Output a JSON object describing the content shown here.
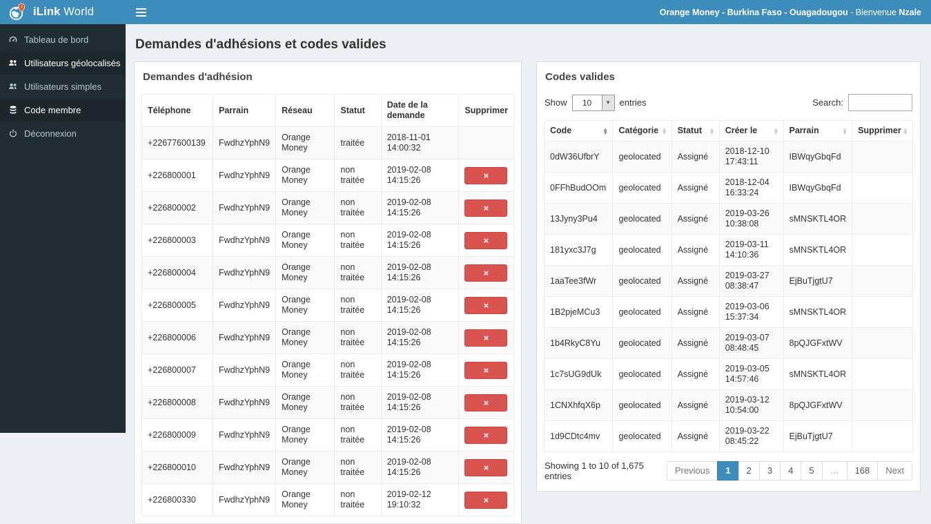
{
  "page_title": "Demandes d'adhésions et codes valides",
  "brand": {
    "bold": "iLink",
    "rest": " World"
  },
  "topbar": {
    "segments": [
      {
        "text": "Orange Money",
        "bold": true
      },
      {
        "text": " - ",
        "bold": true
      },
      {
        "text": "Burkina Faso",
        "bold": true
      },
      {
        "text": " - ",
        "bold": true
      },
      {
        "text": "Ouagadougou",
        "bold": true
      },
      {
        "text": " - ",
        "bold": false
      },
      {
        "text": "Bienvenue ",
        "bold": false
      },
      {
        "text": "Nzale",
        "bold": true
      }
    ]
  },
  "sidebar": {
    "items": [
      {
        "id": "tableau-de-bord",
        "label": "Tableau de bord",
        "icon": "dashboard-icon",
        "active": false
      },
      {
        "id": "utilisateurs-geolocalises",
        "label": "Utilisateurs géolocalisés",
        "icon": "users-icon",
        "active": true
      },
      {
        "id": "utilisateurs-simples",
        "label": "Utilisateurs simples",
        "icon": "users-icon",
        "active": false
      },
      {
        "id": "code-membre",
        "label": "Code membre",
        "icon": "database-icon",
        "active": true
      },
      {
        "id": "deconnexion",
        "label": "Déconnexion",
        "icon": "power-icon",
        "active": false
      }
    ]
  },
  "left_panel": {
    "title": "Demandes d'adhésion",
    "columns": [
      "Téléphone",
      "Parrain",
      "Réseau",
      "Statut",
      "Date de la demande",
      "Supprimer"
    ],
    "delete_icon": "×",
    "rows": [
      {
        "telephone": "+22677600139",
        "parrain": "FwdhzYphN9",
        "reseau": "Orange Money",
        "statut": "traitée",
        "date": "2018-11-01 14:00:32",
        "deletable": false
      },
      {
        "telephone": "+226800001",
        "parrain": "FwdhzYphN9",
        "reseau": "Orange Money",
        "statut": "non traitée",
        "date": "2019-02-08 14:15:26",
        "deletable": true
      },
      {
        "telephone": "+226800002",
        "parrain": "FwdhzYphN9",
        "reseau": "Orange Money",
        "statut": "non traitée",
        "date": "2019-02-08 14:15:26",
        "deletable": true
      },
      {
        "telephone": "+226800003",
        "parrain": "FwdhzYphN9",
        "reseau": "Orange Money",
        "statut": "non traitée",
        "date": "2019-02-08 14:15:26",
        "deletable": true
      },
      {
        "telephone": "+226800004",
        "parrain": "FwdhzYphN9",
        "reseau": "Orange Money",
        "statut": "non traitée",
        "date": "2019-02-08 14:15:26",
        "deletable": true
      },
      {
        "telephone": "+226800005",
        "parrain": "FwdhzYphN9",
        "reseau": "Orange Money",
        "statut": "non traitée",
        "date": "2019-02-08 14:15:26",
        "deletable": true
      },
      {
        "telephone": "+226800006",
        "parrain": "FwdhzYphN9",
        "reseau": "Orange Money",
        "statut": "non traitée",
        "date": "2019-02-08 14:15:26",
        "deletable": true
      },
      {
        "telephone": "+226800007",
        "parrain": "FwdhzYphN9",
        "reseau": "Orange Money",
        "statut": "non traitée",
        "date": "2019-02-08 14:15:26",
        "deletable": true
      },
      {
        "telephone": "+226800008",
        "parrain": "FwdhzYphN9",
        "reseau": "Orange Money",
        "statut": "non traitée",
        "date": "2019-02-08 14:15:26",
        "deletable": true
      },
      {
        "telephone": "+226800009",
        "parrain": "FwdhzYphN9",
        "reseau": "Orange Money",
        "statut": "non traitée",
        "date": "2019-02-08 14:15:26",
        "deletable": true
      },
      {
        "telephone": "+226800010",
        "parrain": "FwdhzYphN9",
        "reseau": "Orange Money",
        "statut": "non traitée",
        "date": "2019-02-08 14:15:26",
        "deletable": true
      },
      {
        "telephone": "+226800330",
        "parrain": "FwdhzYphN9",
        "reseau": "Orange Money",
        "statut": "non traitée",
        "date": "2019-02-12 19:10:32",
        "deletable": true
      }
    ]
  },
  "right_panel": {
    "title": "Codes valides",
    "show_label": "Show",
    "page_size": "10",
    "entries_label": "entries",
    "search_label": "Search:",
    "search_value": "",
    "columns": [
      {
        "label": "Code",
        "sorted": true
      },
      {
        "label": "Catégorie",
        "sorted": false
      },
      {
        "label": "Statut",
        "sorted": false
      },
      {
        "label": "Créer le",
        "sorted": false
      },
      {
        "label": "Parrain",
        "sorted": false
      },
      {
        "label": "Supprimer",
        "sorted": false
      }
    ],
    "rows": [
      {
        "code": "0dW36UfbrY",
        "categorie": "geolocated",
        "statut": "Assigné",
        "cree_le": "2018-12-10 17:43:11",
        "parrain": "IBWqyGbqFd"
      },
      {
        "code": "0FFhBudOOm",
        "categorie": "geolocated",
        "statut": "Assigné",
        "cree_le": "2018-12-04 16:33:24",
        "parrain": "IBWqyGbqFd"
      },
      {
        "code": "13Jyny3Pu4",
        "categorie": "geolocated",
        "statut": "Assigné",
        "cree_le": "2019-03-26 10:38:08",
        "parrain": "sMNSKTL4OR"
      },
      {
        "code": "181yxc3J7g",
        "categorie": "geolocated",
        "statut": "Assigné",
        "cree_le": "2019-03-11 14:10:36",
        "parrain": "sMNSKTL4OR"
      },
      {
        "code": "1aaTee3fWr",
        "categorie": "geolocated",
        "statut": "Assigné",
        "cree_le": "2019-03-27 08:38:47",
        "parrain": "EjBuTjgtU7"
      },
      {
        "code": "1B2pjeMCu3",
        "categorie": "geolocated",
        "statut": "Assigné",
        "cree_le": "2019-03-06 15:37:34",
        "parrain": "sMNSKTL4OR"
      },
      {
        "code": "1b4RkyC8Yu",
        "categorie": "geolocated",
        "statut": "Assigné",
        "cree_le": "2019-03-07 08:48:45",
        "parrain": "8pQJGFxtWV"
      },
      {
        "code": "1c7sUG9dUk",
        "categorie": "geolocated",
        "statut": "Assigné",
        "cree_le": "2019-03-05 14:57:46",
        "parrain": "sMNSKTL4OR"
      },
      {
        "code": "1CNXhfqX6p",
        "categorie": "geolocated",
        "statut": "Assigné",
        "cree_le": "2019-03-12 10:54:00",
        "parrain": "8pQJGFxtWV"
      },
      {
        "code": "1d9CDtc4mv",
        "categorie": "geolocated",
        "statut": "Assigné",
        "cree_le": "2019-03-22 08:45:22",
        "parrain": "EjBuTjgtU7"
      }
    ],
    "footer": {
      "info": "Showing 1 to 10 of 1,675 entries",
      "pages": [
        {
          "label": "Previous",
          "kind": "prev"
        },
        {
          "label": "1",
          "active": true
        },
        {
          "label": "2"
        },
        {
          "label": "3"
        },
        {
          "label": "4"
        },
        {
          "label": "5"
        },
        {
          "label": "…",
          "disabled": true
        },
        {
          "label": "168"
        },
        {
          "label": "Next",
          "kind": "next"
        }
      ]
    }
  },
  "colors": {
    "accent": "#3c8dbc",
    "sidebar_bg": "#222d32",
    "sidebar_active_bg": "#1e282c",
    "danger": "#d9534f",
    "content_bg": "#ecf0f5"
  }
}
